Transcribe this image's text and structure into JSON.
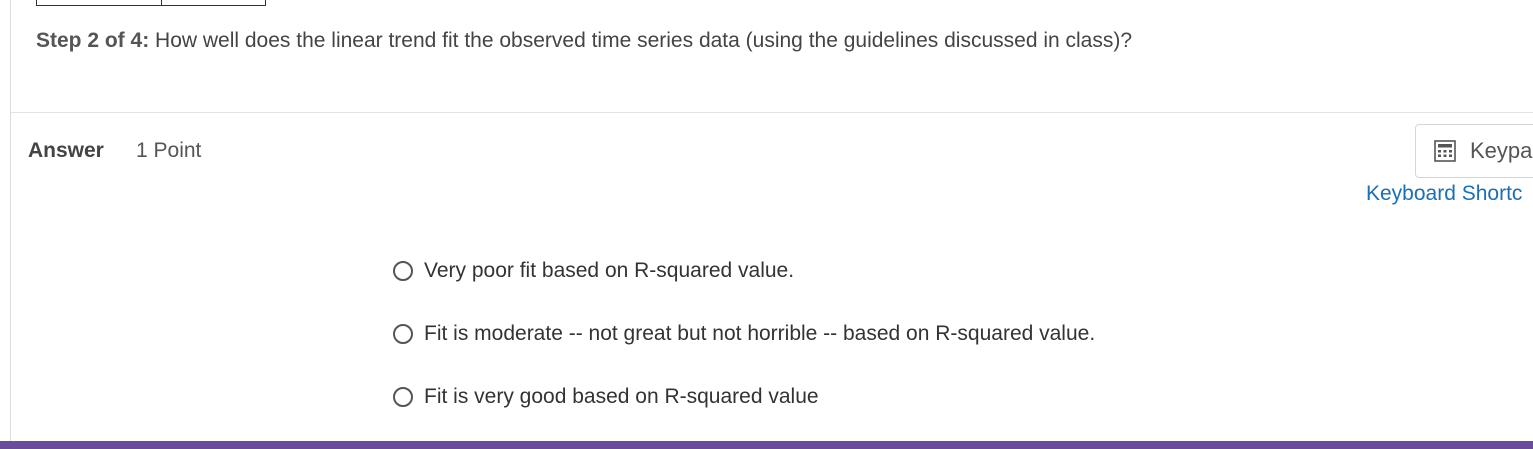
{
  "question": {
    "step_label": "Step 2 of 4:",
    "text": " How well does the linear trend fit the observed time series data (using the guidelines discussed in class)?"
  },
  "answer": {
    "heading": "Answer",
    "points": "1 Point"
  },
  "tools": {
    "keypad_label": "Keypa",
    "keypad_icon": "calculator-icon",
    "shortcuts_label": "Keyboard Shortc"
  },
  "options": [
    {
      "label": "Very poor fit based on R-squared value.",
      "selected": false
    },
    {
      "label": "Fit is moderate -- not great but not horrible -- based on R-squared value.",
      "selected": false
    },
    {
      "label": "Fit is very good based on R-squared value",
      "selected": false
    }
  ],
  "colors": {
    "link": "#1a6fb5",
    "bottom_bar": "#6b4c9a"
  }
}
